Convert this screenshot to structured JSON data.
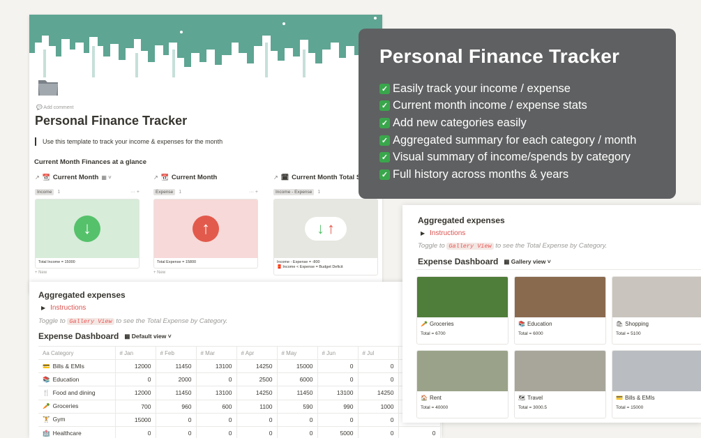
{
  "page": {
    "add_comment": "Add comment",
    "title": "Personal Finance Tracker",
    "quote": "Use this template to track your income & expenses for the month",
    "section_heading": "Current Month Finances at a glance",
    "columns": [
      {
        "title": "Current Month",
        "tag": "Income",
        "count": "1",
        "caption": "Total Income = 15000",
        "caption2": "",
        "new": "New",
        "bg": "#d7ecd9",
        "circle": "#55c16b",
        "icon": "arrow-down-icon"
      },
      {
        "title": "Current Month",
        "tag": "Expense",
        "count": "1",
        "caption": "Total Expense = 15800",
        "caption2": "",
        "new": "New",
        "bg": "#f6d9d8",
        "circle": "#e25a4c",
        "icon": "arrow-up-icon"
      },
      {
        "title": "Current Month Total St",
        "tag": "Income - Expense",
        "count": "1",
        "caption": "Income - Expense = -800",
        "caption2": "Income < Expense = Budget Deficit",
        "new": "",
        "bg": "#e5e7e0",
        "circle": "#ffffff",
        "icon": "arrow-down-up-icon"
      }
    ]
  },
  "overlay": {
    "title": "Personal Finance Tracker",
    "items": [
      "Easily track your income / expense",
      "Current month income / expense stats",
      "Add new categories easily",
      "Aggregated summary for each category / month",
      "Visual summary of income/spends by category",
      "Full history across months & years"
    ]
  },
  "table_panel": {
    "heading": "Aggregated expenses",
    "toggle": "Instructions",
    "hint_pre": "Toggle to",
    "hint_code": "Gallery View",
    "hint_post": "to see the Total Expense by Category.",
    "dashboard_title": "Expense Dashboard",
    "view_label": "Default view",
    "columns": [
      "Category",
      "Jan",
      "Feb",
      "Mar",
      "Apr",
      "May",
      "Jun",
      "Jul"
    ],
    "rows": [
      {
        "icon": "💳",
        "category": "Bills & EMIs",
        "values": [
          "12000",
          "11450",
          "13100",
          "14250",
          "15000",
          "0",
          "0"
        ]
      },
      {
        "icon": "📚",
        "category": "Education",
        "values": [
          "0",
          "2000",
          "0",
          "2500",
          "6000",
          "0",
          "0"
        ]
      },
      {
        "icon": "🍴",
        "category": "Food and dining",
        "values": [
          "12000",
          "11450",
          "13100",
          "14250",
          "11450",
          "13100",
          "14250"
        ]
      },
      {
        "icon": "🥕",
        "category": "Groceries",
        "values": [
          "700",
          "960",
          "600",
          "1100",
          "590",
          "990",
          "1000"
        ]
      },
      {
        "icon": "🏋",
        "category": "Gym",
        "values": [
          "15000",
          "0",
          "0",
          "0",
          "0",
          "0",
          "0"
        ]
      },
      {
        "icon": "🏥",
        "category": "Healthcare",
        "values": [
          "0",
          "0",
          "0",
          "0",
          "0",
          "5000",
          "0"
        ]
      }
    ],
    "extra_col_value": "0"
  },
  "gallery_panel": {
    "heading": "Aggregated expenses",
    "toggle": "Instructions",
    "hint_pre": "Toggle to",
    "hint_code": "Gallery View",
    "hint_post": "to see the Total Expense by Category.",
    "dashboard_title": "Expense Dashboard",
    "view_label": "Gallery view",
    "cards": [
      {
        "icon": "🥕",
        "name": "Groceries",
        "total": "Total = 6700",
        "color": "#4f7d3a"
      },
      {
        "icon": "📚",
        "name": "Education",
        "total": "Total = 6000",
        "color": "#8a6a4f"
      },
      {
        "icon": "🛍",
        "name": "Shopping",
        "total": "Total = 5100",
        "color": "#c9c4bd"
      },
      {
        "icon": "🏠",
        "name": "Rent",
        "total": "Total = 40000",
        "color": "#9aa389"
      },
      {
        "icon": "🗺",
        "name": "Travel",
        "total": "Total = 3000.5",
        "color": "#a8a59b"
      },
      {
        "icon": "💳",
        "name": "Bills & EMIs",
        "total": "Total = 15000",
        "color": "#b9bdc1"
      }
    ]
  }
}
